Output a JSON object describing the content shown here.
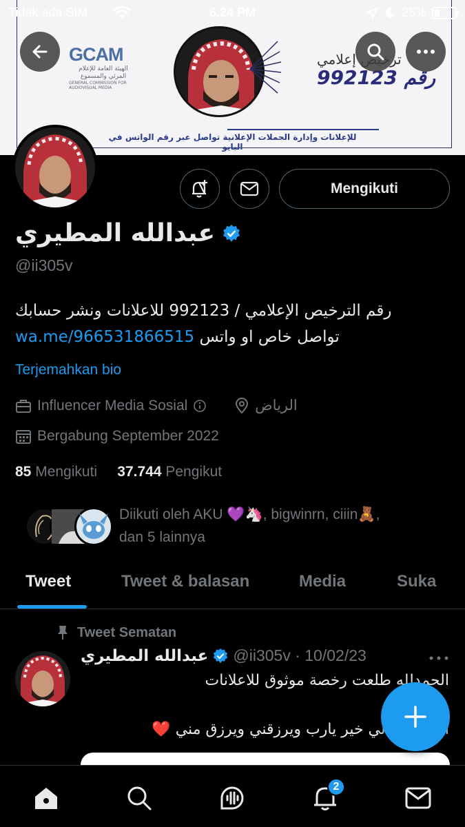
{
  "status_bar": {
    "carrier": "Tidak ada SIM",
    "time": "6.24 PM",
    "battery": "25%"
  },
  "banner": {
    "gcam_logo": "GCAM",
    "gcam_arabic": "الهيئة العامة للإعلام المرئي والمسموع",
    "gcam_english": "GENERAL COMMISSION FOR AUDIOVISUAL MEDIA",
    "license_line1": "ترخيص إعلامي",
    "license_line2": "رقم 992123",
    "tagline": "للإعلانات وإدارة الحملات الإعلانية تواصل عبر رقم الواتس في البايو"
  },
  "profile": {
    "name": "عبدالله المطيري",
    "handle": "@ii305v",
    "bio_line1": "رقم الترخيص الإعلامي / 992123 للاعلانات ونشر حسابك",
    "bio_link": "wa.me/966531866515",
    "bio_line2_rest": " تواصل خاص او واتس",
    "translate_label": "Terjemahkan bio",
    "category": "Influencer Media Sosial",
    "location": "الرياض",
    "joined": "Bergabung September 2022",
    "following_count": "85",
    "following_label": "Mengikuti",
    "followers_count": "37.744",
    "followers_label": "Pengikut",
    "followed_by_line1": "Diikuti oleh AKU 💜🦄, bigwinrn, ciiin🧸,",
    "followed_by_line2": "dan 5 lainnya",
    "follow_button": "Mengikuti"
  },
  "tabs": [
    {
      "label": "Tweet"
    },
    {
      "label": "Tweet & balasan"
    },
    {
      "label": "Media"
    },
    {
      "label": "Suka"
    }
  ],
  "pinned_tweet": {
    "pinned_label": "Tweet Sematan",
    "author_name": "عبدالله المطيري",
    "author_handle_date": "@ii305v · 10/02/23",
    "line1": "الحمدلله طلعت رخصة موثوق للاعلانات",
    "line2": "الله يكتب لي خير يارب ويرزقني ويرزق مني ❤️"
  },
  "bottom_nav": {
    "notification_badge": "2"
  },
  "colors": {
    "accent": "#1d9bf0",
    "background": "#000000",
    "muted_text": "#71767b"
  },
  "icons": [
    "back-arrow-icon",
    "search-icon",
    "more-icon",
    "bell-plus-icon",
    "mail-icon",
    "verified-badge-icon",
    "briefcase-icon",
    "info-icon",
    "location-pin-icon",
    "calendar-icon",
    "pin-icon",
    "plus-icon",
    "home-icon",
    "spaces-icon",
    "bell-icon"
  ]
}
